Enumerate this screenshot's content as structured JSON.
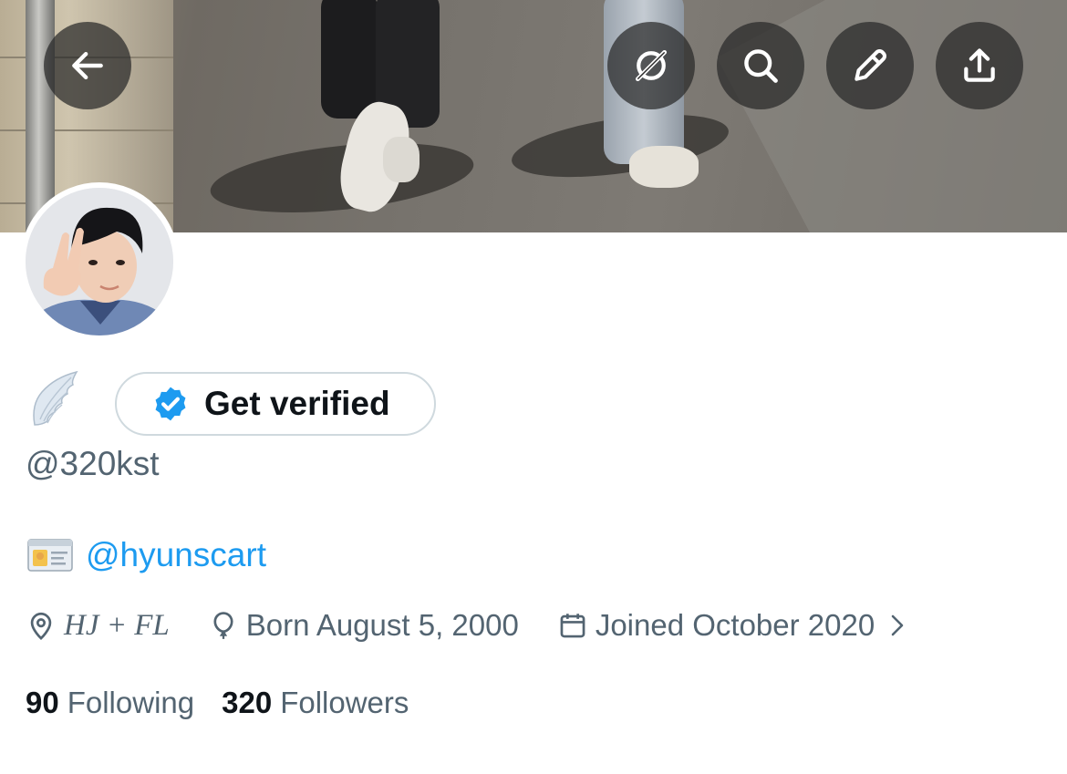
{
  "header": {
    "back_icon": "arrow-left-icon",
    "actions": [
      {
        "icon": "grok-icon"
      },
      {
        "icon": "search-icon"
      },
      {
        "icon": "pencil-icon"
      },
      {
        "icon": "share-icon"
      }
    ]
  },
  "profile": {
    "name_emoji": "wing-emoji",
    "verify_label": "Get verified",
    "handle": "@320kst",
    "bio_emoji": "id-card-emoji",
    "bio_link": "@hyunscart",
    "location": "HJ + FL",
    "birthday": "Born August 5, 2000",
    "joined": "Joined October 2020",
    "following_count": "90",
    "following_label": "Following",
    "followers_count": "320",
    "followers_label": "Followers"
  },
  "colors": {
    "link": "#1d9bf0",
    "secondary_text": "#536471",
    "primary_text": "#0f1419",
    "verified_badge": "#1d9bf0",
    "button_border": "#cfd9de"
  }
}
